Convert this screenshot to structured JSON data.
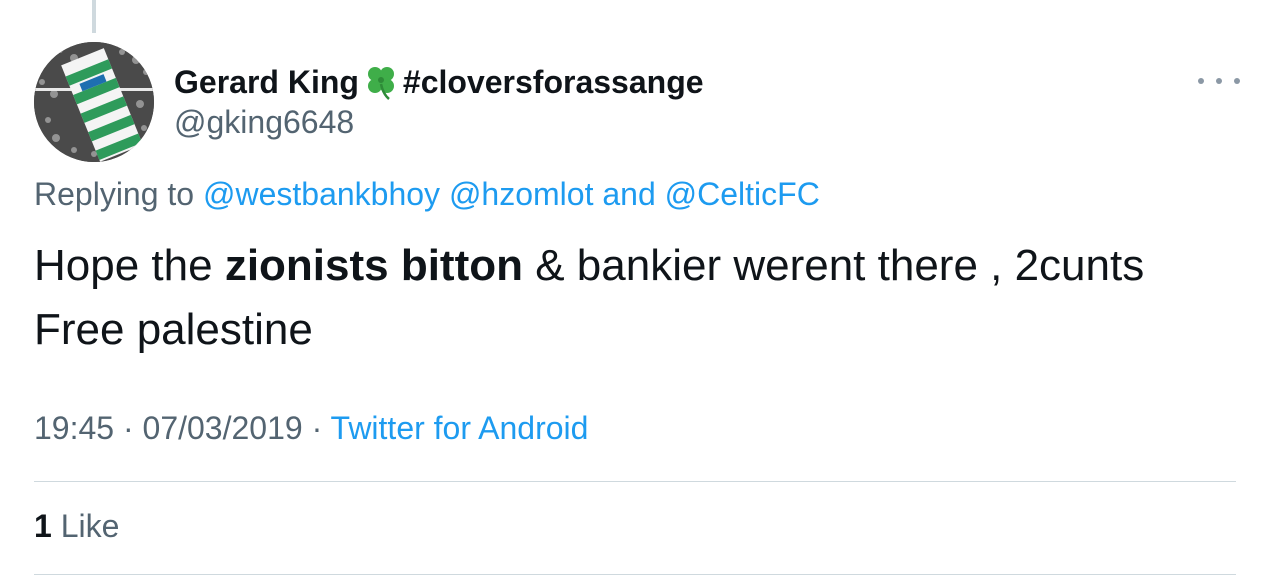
{
  "author": {
    "display_name": "Gerard King",
    "name_emoji": "four-leaf-clover-icon",
    "name_hashtag": "#cloversforassange",
    "handle": "@gking6648"
  },
  "reply": {
    "prefix": "Replying to",
    "mention_1": "@westbankbhoy",
    "mention_2": "@hzomlot",
    "conjunction": "and",
    "mention_3": "@CelticFC"
  },
  "tweet": {
    "text_1": "Hope the ",
    "bold_text": "zionists bitton",
    "text_2": " & bankier werent there , 2cunts",
    "line_2": "Free palestine"
  },
  "meta": {
    "time": "19:45",
    "separator": " · ",
    "date": "07/03/2019",
    "source": "Twitter for Android"
  },
  "stats": {
    "like_count": "1",
    "like_label": "Like"
  },
  "colors": {
    "link": "#1d9bf0",
    "secondary_text": "#536471",
    "primary_text": "#0f1419",
    "divider": "#cfd9de"
  }
}
